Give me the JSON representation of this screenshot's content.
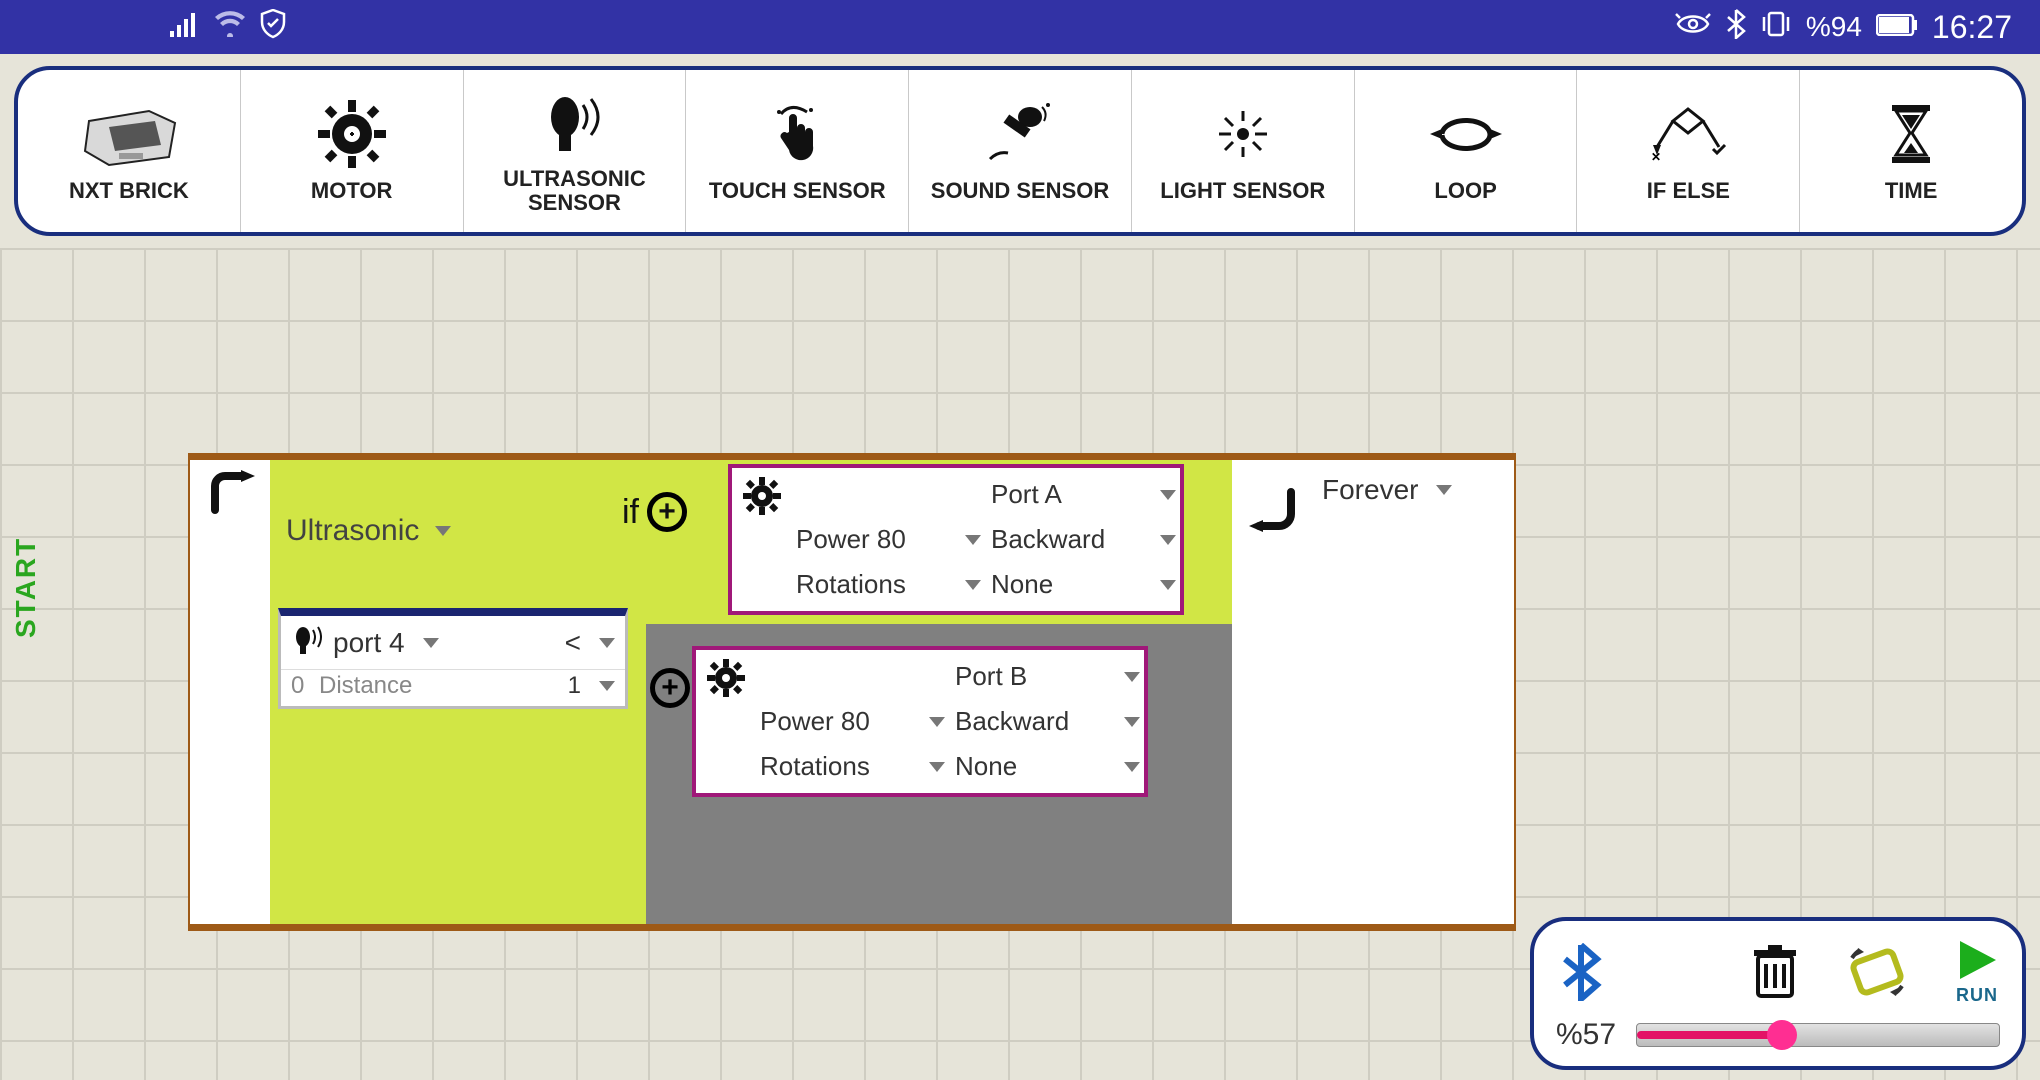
{
  "status": {
    "battery_text": "%94",
    "time": "16:27"
  },
  "toolbar": [
    {
      "label": "NXT BRICK",
      "icon": "brick-icon"
    },
    {
      "label": "MOTOR",
      "icon": "gear-icon"
    },
    {
      "label": "ULTRASONIC SENSOR",
      "icon": "ultrasonic-icon"
    },
    {
      "label": "TOUCH SENSOR",
      "icon": "touch-icon"
    },
    {
      "label": "SOUND SENSOR",
      "icon": "mic-icon"
    },
    {
      "label": "LIGHT SENSOR",
      "icon": "light-icon"
    },
    {
      "label": "LOOP",
      "icon": "loop-icon"
    },
    {
      "label": "IF ELSE",
      "icon": "ifelse-icon"
    },
    {
      "label": "TIME",
      "icon": "hourglass-icon"
    }
  ],
  "canvas": {
    "start_label": "START"
  },
  "program": {
    "sensor_type": "Ultrasonic",
    "if_label": "if",
    "sensor_box": {
      "port": "port 4",
      "compare": "<",
      "left_val": "0",
      "variable": "Distance",
      "right_val": "1"
    },
    "motor_a": {
      "port": "Port A",
      "power": "Power 80",
      "direction": "Backward",
      "rotations": "Rotations",
      "end": "None"
    },
    "motor_b": {
      "port": "Port B",
      "power": "Power 80",
      "direction": "Backward",
      "rotations": "Rotations",
      "end": "None"
    },
    "loop": "Forever"
  },
  "control_panel": {
    "run_label": "RUN",
    "slider_percent_text": "%57",
    "slider_percent": 40
  }
}
